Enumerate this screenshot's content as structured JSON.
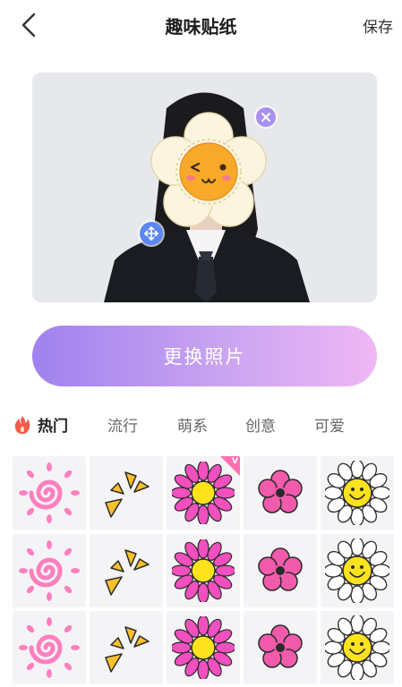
{
  "header": {
    "title": "趣味贴纸",
    "save_label": "保存",
    "back_icon": "chevron-left-icon"
  },
  "photo": {
    "close_icon": "close-icon",
    "move_icon": "move-arrows-icon"
  },
  "button": {
    "label": "更换照片"
  },
  "tabs": [
    {
      "label": "热门",
      "active": true,
      "icon": "fire-icon"
    },
    {
      "label": "流行",
      "active": false
    },
    {
      "label": "萌系",
      "active": false
    },
    {
      "label": "创意",
      "active": false
    },
    {
      "label": "可爱",
      "active": false
    }
  ],
  "stickers": {
    "columns": [
      "pink-swirl-sun",
      "yellow-burst",
      "pink-sunflower",
      "pink-flower",
      "smiley-daisy"
    ],
    "rows": 3,
    "vip_badge": "V"
  },
  "colors": {
    "accent_start": "#a082ef",
    "accent_end": "#efb7f5",
    "fire": "#f25b4a",
    "vip_corner": "#ff6fb3"
  }
}
